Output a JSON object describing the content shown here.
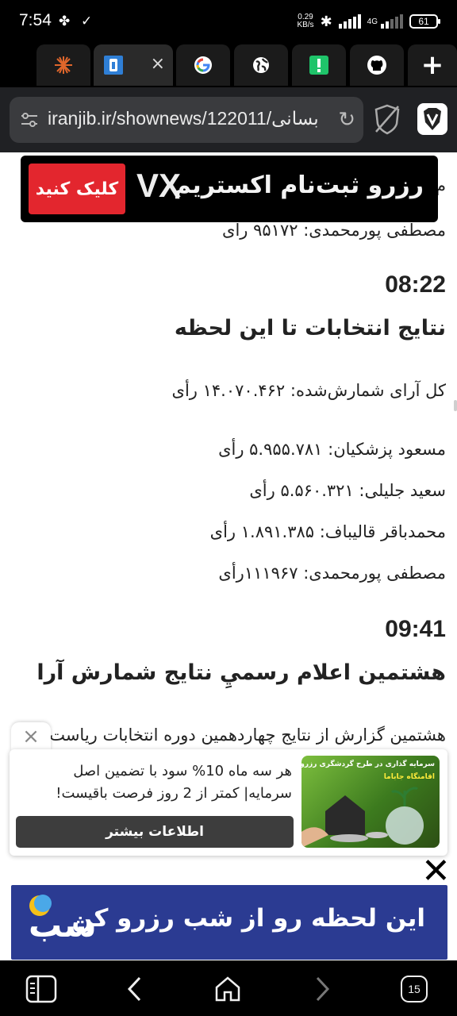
{
  "status_bar": {
    "time": "7:54",
    "net_speed_value": "0.29",
    "net_speed_unit": "KB/s",
    "network_type": "4G",
    "battery": "61"
  },
  "tabs": [
    {
      "icon": "asterisk-favicon-icon",
      "active": false
    },
    {
      "icon": "iranjib-favicon-icon",
      "active": true,
      "close": "×"
    },
    {
      "icon": "google-favicon-icon",
      "active": false
    },
    {
      "icon": "globe-favicon-icon",
      "active": false
    },
    {
      "icon": "exclamation-favicon-icon",
      "active": false
    },
    {
      "icon": "github-favicon-icon",
      "active": false
    }
  ],
  "new_tab_label": "+",
  "toolbar": {
    "url": "iranjib.ir/shownews/122011/بسانی",
    "reload_icon": "↻"
  },
  "content": {
    "top_partial_line": "م",
    "prev_line": "مصطفی پورمحمدی:  ۹۵۱۷۲ رای",
    "time1": "08:22",
    "heading1": "نتایج انتخابات تا این لحظه",
    "total": "کل آرای شمارش‌شده: ۱۴.۰۷۰.۴۶۲ رأی",
    "results": [
      "مسعود پزشکیان: ۵.۹۵۵.۷۸۱ رأی",
      "سعید جلیلی: ۵.۵۶۰.۳۲۱ رأی",
      "محمدباقر قالیباف: ۱.۸۹۱.۳۸۵ رأی",
      "مصطفی پورمحمدی: ۱۱۱۹۶۷رأی"
    ],
    "time2": "09:41",
    "heading2": "هشتمین اعلام رسميِ نتایج شمارش آرا",
    "para_start": "هشتمین گزارش از نتایج چهاردهمین دوره انتخابات ریاست"
  },
  "top_ad": {
    "text": "رزرو ثبت‌نام اکستریم",
    "brand": "VX",
    "button": "کلیک کنید"
  },
  "card_ad": {
    "close": "×",
    "line1": "هر سه ماه 10% سود با تضمین اصل",
    "line2": "سرمایه| کمتر از 2 روز فرصت باقیست!",
    "button": "اطلاعات بیشتر",
    "image_caption": "سرمایه گذاری در طرح گردشگری رزرو",
    "image_subcaption": "اقامتگاه جاباما"
  },
  "bottom_ad": {
    "close": "✕",
    "text": "این لحظه رو از شب رزرو کن",
    "logo": "شب"
  },
  "bottom_nav": {
    "tabs_count": "15"
  }
}
